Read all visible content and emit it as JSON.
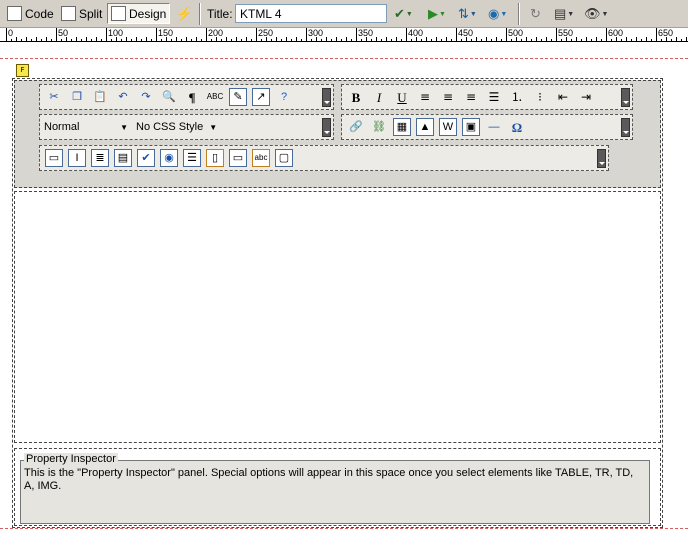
{
  "toolbar": {
    "view_buttons": [
      {
        "label": "Code",
        "icon": "code-view-icon"
      },
      {
        "label": "Split",
        "icon": "split-view-icon"
      },
      {
        "label": "Design",
        "icon": "design-view-icon",
        "active": true
      }
    ],
    "title_label": "Title:",
    "title_value": "KTML 4"
  },
  "ruler": {
    "labels": [
      "0",
      "50",
      "100",
      "150",
      "200",
      "250",
      "300",
      "350",
      "400",
      "450",
      "500",
      "550",
      "600",
      "650"
    ]
  },
  "editor": {
    "style_select": "Normal",
    "css_select": "No CSS Style"
  },
  "property_inspector": {
    "title": "Property Inspector",
    "text": "This is the \"Property Inspector\" panel. Special options will appear in this space once you select elements like TABLE, TR, TD, A, IMG."
  }
}
